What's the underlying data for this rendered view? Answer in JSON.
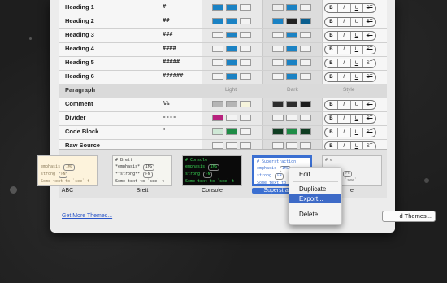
{
  "table": {
    "column_headers": {
      "light": "Light",
      "dark": "Dark",
      "style": "Style"
    },
    "style_buttons": [
      "B",
      "I",
      "U",
      "ST"
    ],
    "rows": [
      {
        "name": "Heading 1",
        "syntax": "#",
        "light": [
          "#1a82c4",
          "#1a82c4",
          "#f3f3f3"
        ],
        "dark": [
          "#ededed",
          "#1a82c4",
          "#f3f3f3"
        ]
      },
      {
        "name": "Heading 2",
        "syntax": "##",
        "light": [
          "#1a82c4",
          "#1a82c4",
          "#f3f3f3"
        ],
        "dark": [
          "#1a82c4",
          "#222222",
          "#0a5f8f"
        ]
      },
      {
        "name": "Heading 3",
        "syntax": "###",
        "light": [
          "#f3f3f3",
          "#1a82c4",
          "#f3f3f3"
        ],
        "dark": [
          "#f3f3f3",
          "#1a82c4",
          "#f3f3f3"
        ]
      },
      {
        "name": "Heading 4",
        "syntax": "####",
        "light": [
          "#f3f3f3",
          "#1a82c4",
          "#f3f3f3"
        ],
        "dark": [
          "#f3f3f3",
          "#1a82c4",
          "#f3f3f3"
        ]
      },
      {
        "name": "Heading 5",
        "syntax": "#####",
        "light": [
          "#f3f3f3",
          "#1a82c4",
          "#f3f3f3"
        ],
        "dark": [
          "#f3f3f3",
          "#1a82c4",
          "#f3f3f3"
        ]
      },
      {
        "name": "Heading 6",
        "syntax": "######",
        "light": [
          "#f3f3f3",
          "#1a82c4",
          "#f3f3f3"
        ],
        "dark": [
          "#f3f3f3",
          "#1a82c4",
          "#f3f3f3"
        ]
      }
    ],
    "section_label": "Paragraph",
    "rows2": [
      {
        "name": "Comment",
        "syntax": "%%",
        "light": [
          "#b5b5b5",
          "#b5b5b5",
          "#f6f4dc"
        ],
        "dark": [
          "#2d2d2d",
          "#2d2d2d",
          "#1c1c1c"
        ]
      },
      {
        "name": "Divider",
        "syntax": "----",
        "light": [
          "#b8217e",
          "#f3f3f3",
          "#f3f3f3"
        ],
        "dark": [
          "#f3f3f3",
          "#f3f3f3",
          "#f3f3f3"
        ]
      },
      {
        "name": "Code Block",
        "syntax": "' '",
        "light": [
          "#cfe8d6",
          "#1e8c46",
          "#f3f3f3"
        ],
        "dark": [
          "#0f3d22",
          "#1e8c46",
          "#0f3d22"
        ]
      },
      {
        "name": "Raw Source",
        "syntax": "",
        "light": [
          "#f3f3f3",
          "#f3f3f3",
          "#f3f3f3"
        ],
        "dark": [
          "#f3f3f3",
          "#f3f3f3",
          "#f3f3f3"
        ]
      }
    ]
  },
  "themes": [
    {
      "name": "ABC",
      "bg": "#fdf3dc",
      "fg": "#8a7a5a",
      "lines": [
        "",
        "emphasis",
        "strong",
        "Some text to `see` t"
      ],
      "selected": false
    },
    {
      "name": "Brett",
      "bg": "#f5f5f0",
      "fg": "#333333",
      "lines": [
        "# Brett",
        "*emphasis*",
        "**strong**",
        "Some text to `see` t"
      ],
      "selected": false
    },
    {
      "name": "Console",
      "bg": "#0a0a0a",
      "fg": "#39d353",
      "lines": [
        "# Console",
        "emphasis",
        "strong",
        "Some text to `see` t"
      ],
      "selected": false
    },
    {
      "name": "Superstraction",
      "bg": "#ffffff",
      "fg": "#3b6fd1",
      "lines": [
        "# Superstraction",
        "emphasis",
        "strong",
        "Some text to `see` t"
      ],
      "selected": true
    },
    {
      "name": "e",
      "bg": "#f0f0f0",
      "fg": "#666666",
      "lines": [
        "# e",
        "",
        "strong",
        "text to `see`"
      ],
      "selected": false
    }
  ],
  "chips": {
    "img": "IMG",
    "fn": "FN"
  },
  "footer": {
    "get_more_link": "Get More Themes...",
    "add_themes_button": "d Themes..."
  },
  "context_menu": {
    "items": [
      "Edit...",
      "Duplicate",
      "Export...",
      "Delete..."
    ],
    "highlighted": "Export..."
  }
}
